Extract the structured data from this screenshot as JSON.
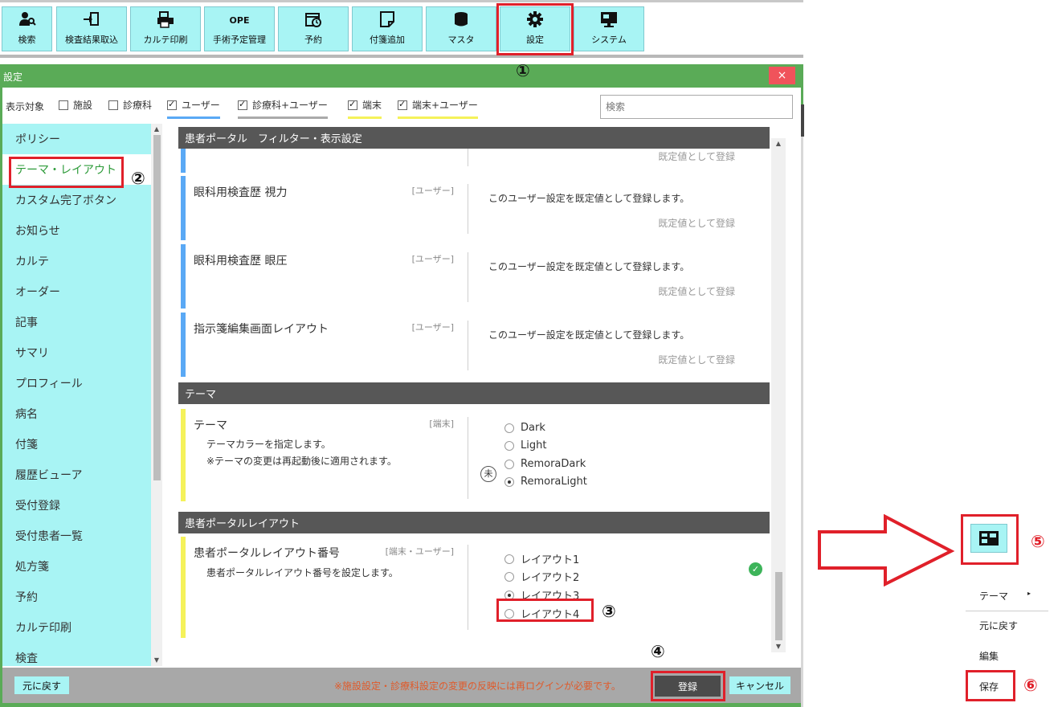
{
  "toolbar": {
    "buttons": [
      {
        "label": "検索"
      },
      {
        "label": "検査結果取込"
      },
      {
        "label": "カルテ印刷"
      },
      {
        "label": "手術予定管理",
        "badge": "OPE"
      },
      {
        "label": "予約"
      },
      {
        "label": "付箋追加"
      },
      {
        "label": "マスタ"
      },
      {
        "label": "設定"
      },
      {
        "label": "システム"
      }
    ]
  },
  "annotations": [
    "①",
    "②",
    "③",
    "④",
    "⑤",
    "⑥"
  ],
  "dialog": {
    "title": "設定",
    "close": "×",
    "filter": {
      "label": "表示対象",
      "items": [
        {
          "label": "施設",
          "checked": false
        },
        {
          "label": "診療科",
          "checked": false
        },
        {
          "label": "ユーザー",
          "checked": true,
          "underline": "#5aa9f5"
        },
        {
          "label": "診療科+ユーザー",
          "checked": true,
          "underline": "#aaaaaa"
        },
        {
          "label": "端末",
          "checked": true,
          "underline": "#f5f25a"
        },
        {
          "label": "端末+ユーザー",
          "checked": true,
          "underline": "#f5f25a"
        }
      ],
      "search_placeholder": "検索"
    },
    "sidebar": {
      "items": [
        {
          "label": "ポリシー"
        },
        {
          "label": "テーマ・レイアウト",
          "active": true
        },
        {
          "label": "カスタム完了ボタン"
        },
        {
          "label": "お知らせ"
        },
        {
          "label": "カルテ"
        },
        {
          "label": "オーダー"
        },
        {
          "label": "記事"
        },
        {
          "label": "サマリ"
        },
        {
          "label": "プロフィール"
        },
        {
          "label": "病名"
        },
        {
          "label": "付箋"
        },
        {
          "label": "履歴ビューア"
        },
        {
          "label": "受付登録"
        },
        {
          "label": "受付患者一覧"
        },
        {
          "label": "処方箋"
        },
        {
          "label": "予約"
        },
        {
          "label": "カルテ印刷"
        },
        {
          "label": "検査"
        }
      ]
    },
    "content": {
      "section_portal_filter": "患者ポータル　フィルター・表示設定",
      "partial_link": "既定値として登録",
      "rows": [
        {
          "name": "眼科用検査歴 視力",
          "scope": "[ユーザー]",
          "text": "このユーザー設定を既定値として登録します。",
          "link": "既定値として登録"
        },
        {
          "name": "眼科用検査歴 眼圧",
          "scope": "[ユーザー]",
          "text": "このユーザー設定を既定値として登録します。",
          "link": "既定値として登録"
        },
        {
          "name": "指示箋編集画面レイアウト",
          "scope": "[ユーザー]",
          "text": "このユーザー設定を既定値として登録します。",
          "link": "既定値として登録"
        }
      ],
      "section_theme": "テーマ",
      "theme": {
        "name": "テーマ",
        "scope": "[端末]",
        "desc1": "テーマカラーを指定します。",
        "desc2": "※テーマの変更は再起動後に適用されます。",
        "unset_icon": "未",
        "options": [
          {
            "label": "Dark",
            "selected": false
          },
          {
            "label": "Light",
            "selected": false
          },
          {
            "label": "RemoraDark",
            "selected": false
          },
          {
            "label": "RemoraLight",
            "selected": true
          }
        ]
      },
      "section_layout": "患者ポータルレイアウト",
      "layout": {
        "name": "患者ポータルレイアウト番号",
        "scope": "[端末・ユーザー]",
        "desc": "患者ポータルレイアウト番号を設定します。",
        "options": [
          {
            "label": "レイアウト1",
            "selected": false
          },
          {
            "label": "レイアウト2",
            "selected": false
          },
          {
            "label": "レイアウト3",
            "selected": true
          },
          {
            "label": "レイアウト4",
            "selected": false
          }
        ]
      }
    },
    "footer": {
      "revert": "元に戻す",
      "note": "※施設設定・診療科設定の変更の反映には再ログインが必要です。",
      "save": "登録",
      "cancel": "キャンセル"
    }
  },
  "side_menu": {
    "items": [
      {
        "label": "テーマ"
      },
      {
        "label": "元に戻す"
      },
      {
        "label": "編集"
      },
      {
        "label": "保存"
      }
    ]
  },
  "colors": {
    "accent_cyan": "#a8f4f4",
    "dialog_green": "#5aab57",
    "highlight_red": "#e0202a",
    "section_dark": "#575757"
  }
}
